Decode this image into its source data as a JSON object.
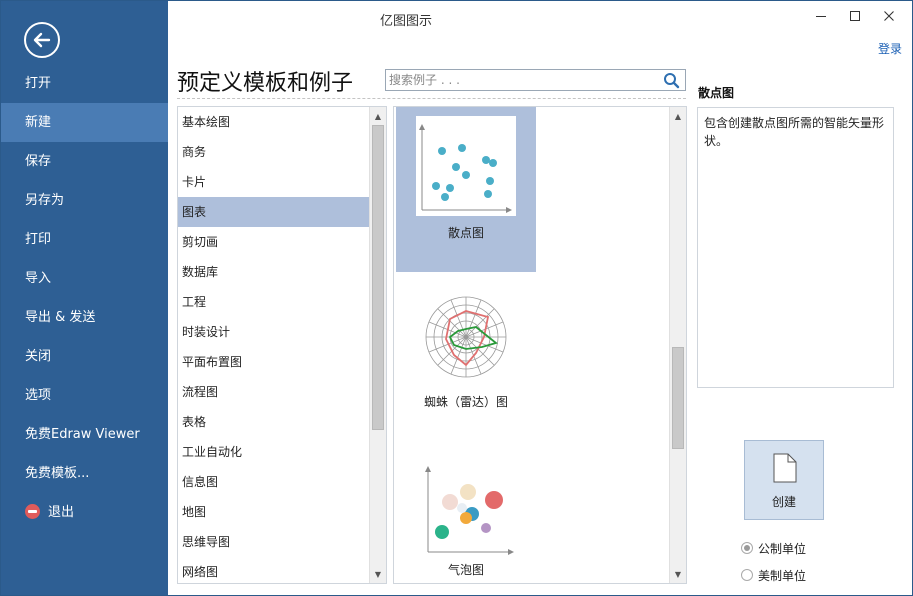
{
  "window": {
    "title": "亿图图示",
    "login": "登录"
  },
  "sidebar": {
    "items": [
      {
        "label": "打开"
      },
      {
        "label": "新建"
      },
      {
        "label": "保存"
      },
      {
        "label": "另存为"
      },
      {
        "label": "打印"
      },
      {
        "label": "导入"
      },
      {
        "label": "导出 & 发送"
      },
      {
        "label": "关闭"
      },
      {
        "label": "选项"
      },
      {
        "label": "免费Edraw Viewer"
      },
      {
        "label": "免费模板..."
      },
      {
        "label": "退出"
      }
    ],
    "active_item": "新建"
  },
  "main": {
    "heading": "预定义模板和例子",
    "search": {
      "placeholder": "搜索例子 . . .",
      "value": ""
    }
  },
  "categories": {
    "items": [
      "基本绘图",
      "商务",
      "卡片",
      "图表",
      "剪切画",
      "数据库",
      "工程",
      "时装设计",
      "平面布置图",
      "流程图",
      "表格",
      "工业自动化",
      "信息图",
      "地图",
      "思维导图",
      "网络图"
    ],
    "selected": "图表"
  },
  "templates": {
    "items": [
      {
        "label": "散点图",
        "icon": "scatter-chart-icon"
      },
      {
        "label": "蜘蛛（雷达）图",
        "icon": "radar-chart-icon"
      },
      {
        "label": "气泡图",
        "icon": "bubble-chart-icon"
      }
    ],
    "selected": "散点图"
  },
  "description": {
    "title": "散点图",
    "text": "包含创建散点图所需的智能矢量形状。"
  },
  "actions": {
    "create_label": "创建"
  },
  "units": {
    "options": [
      "公制单位",
      "美制单位"
    ],
    "selected": "公制单位"
  },
  "colors": {
    "sidebar": "#2e5f94",
    "sidebar_active": "#4a7cb4",
    "selection": "#aebfdb",
    "link": "#1a5fb4",
    "scatter_dot": "#4aaec8"
  }
}
